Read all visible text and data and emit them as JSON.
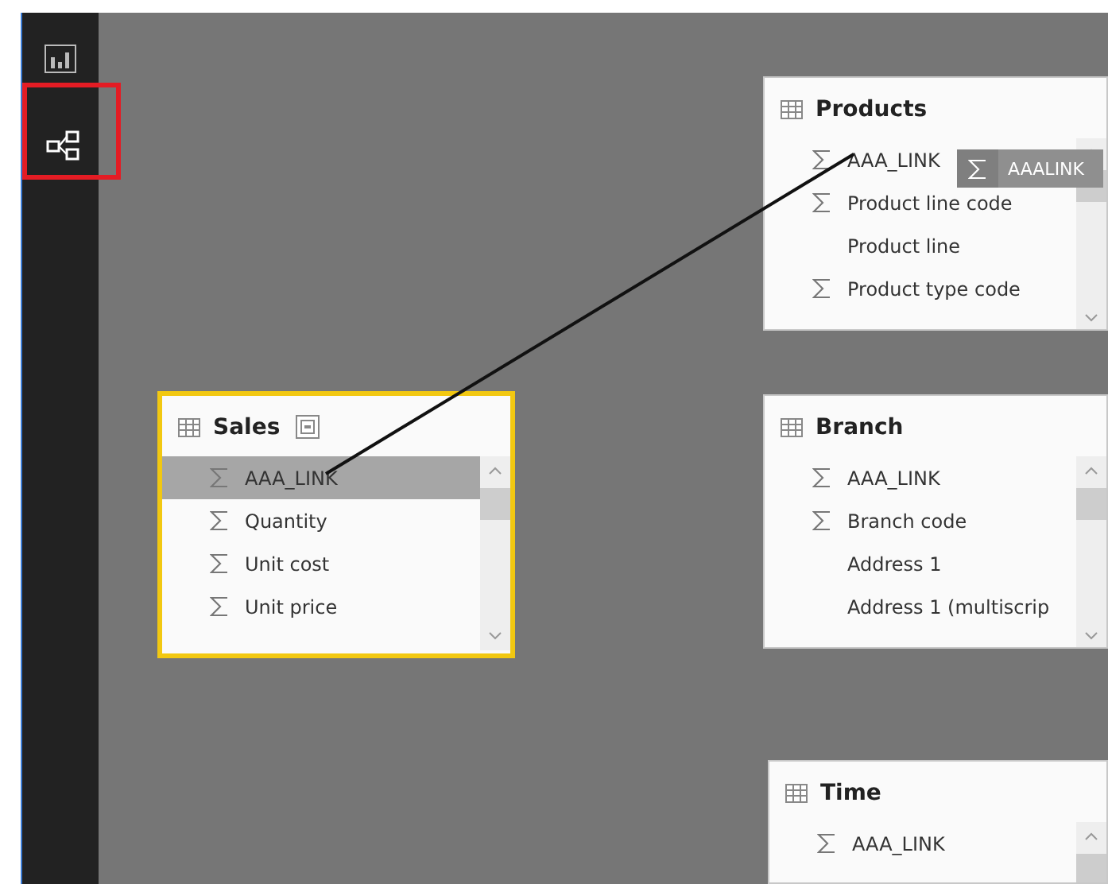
{
  "sidebar": {
    "items": [
      {
        "kind": "report",
        "selected": false
      },
      {
        "kind": "model",
        "selected": true,
        "highlighted": true
      }
    ]
  },
  "tables": [
    {
      "title": "Sales",
      "selected": true,
      "header_icon": true,
      "fields": [
        {
          "name": "AAA_LINK",
          "kind": "numeric",
          "selected": true
        },
        {
          "name": "Quantity",
          "kind": "numeric",
          "selected": false
        },
        {
          "name": "Unit cost",
          "kind": "numeric",
          "selected": false
        },
        {
          "name": "Unit price",
          "kind": "numeric",
          "selected": false
        }
      ]
    },
    {
      "title": "Products",
      "selected": false,
      "header_icon": false,
      "fields": [
        {
          "name": "AAA_LINK",
          "kind": "numeric",
          "selected": false
        },
        {
          "name": "Product line code",
          "kind": "numeric",
          "selected": false
        },
        {
          "name": "Product line",
          "kind": "text",
          "selected": false
        },
        {
          "name": "Product type code",
          "kind": "numeric",
          "selected": false
        }
      ]
    },
    {
      "title": "Branch",
      "selected": false,
      "header_icon": false,
      "fields": [
        {
          "name": "AAA_LINK",
          "kind": "numeric",
          "selected": false
        },
        {
          "name": "Branch code",
          "kind": "numeric",
          "selected": false
        },
        {
          "name": "Address 1",
          "kind": "text",
          "selected": false
        },
        {
          "name": "Address 1 (multiscrip",
          "kind": "text",
          "selected": false
        }
      ]
    },
    {
      "title": "Time",
      "selected": false,
      "header_icon": false,
      "fields": [
        {
          "name": "AAA_LINK",
          "kind": "numeric",
          "selected": false
        }
      ]
    }
  ],
  "drag_ghost": {
    "kind": "numeric",
    "name": "AAALINK"
  }
}
